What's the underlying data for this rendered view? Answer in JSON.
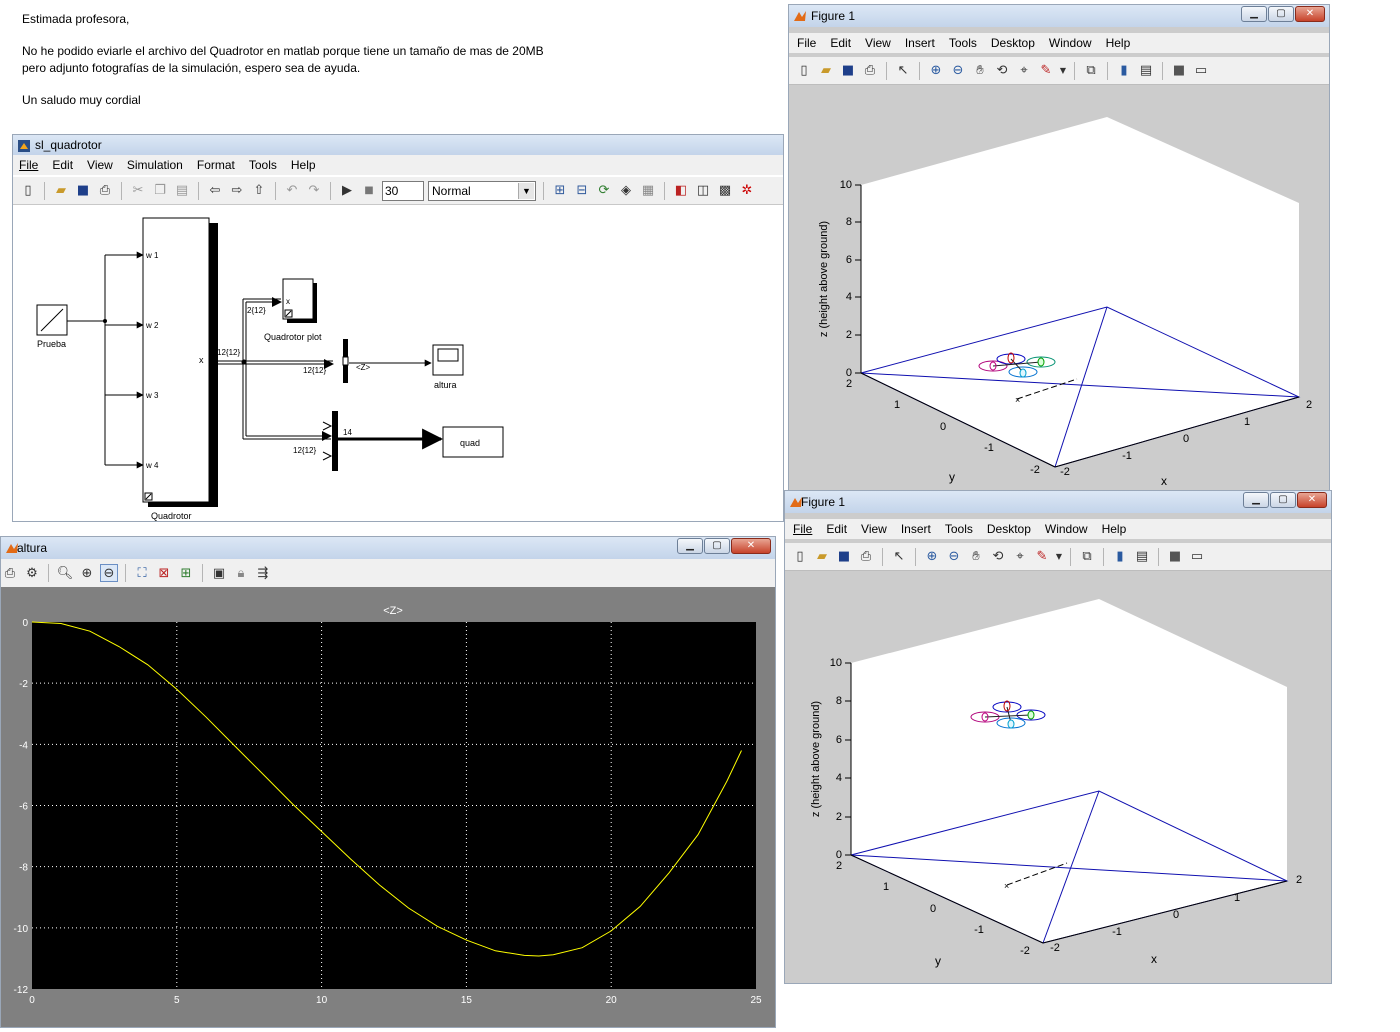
{
  "email": {
    "greeting": "Estimada profesora,",
    "line1": "No he podido eviarle el archivo del Quadrotor en matlab porque tiene un tamaño de mas de 20MB",
    "line2": "pero adjunto fotografías de la simulación, espero sea de ayuda.",
    "closing": "Un saludo muy cordial"
  },
  "simulink": {
    "title": "sl_quadrotor",
    "menu": [
      "File",
      "Edit",
      "View",
      "Simulation",
      "Format",
      "Tools",
      "Help"
    ],
    "stop_time": "30",
    "mode": "Normal",
    "blocks": {
      "prueba": "Prueba",
      "quadrotor": "Quadrotor",
      "quadrotor_plot": "Quadrotor plot",
      "altura": "altura",
      "quad": "quad",
      "w1": "w 1",
      "w2": "w 2",
      "w3": "w 3",
      "w4": "w 4",
      "x_out": "x",
      "x_in": "x",
      "z_sel": "<Z>",
      "sig1": "12{12}",
      "sig2": "2{12}",
      "sig3": "12{12}",
      "sig4": "12{12}",
      "sig5": "14"
    }
  },
  "altura_scope": {
    "title": "altura",
    "plot_title": "<Z>",
    "y_ticks": [
      "0",
      "-2",
      "-4",
      "-6",
      "-8",
      "-10",
      "-12"
    ],
    "x_ticks": [
      "0",
      "5",
      "10",
      "15",
      "20",
      "25"
    ],
    "trace_color": "#ffff00",
    "background_color": "#000000"
  },
  "chart_data": {
    "type": "line",
    "title": "<Z>",
    "xlabel": "",
    "ylabel": "",
    "xlim": [
      0,
      25
    ],
    "ylim": [
      -12,
      0
    ],
    "grid": true,
    "x": [
      0,
      1,
      2,
      3,
      4,
      5,
      6,
      7,
      8,
      9,
      10,
      11,
      12,
      13,
      14,
      15,
      16,
      17,
      17.5,
      18,
      19,
      20,
      21,
      22,
      23,
      24,
      24.5
    ],
    "series": [
      {
        "values": [
          0,
          -0.05,
          -0.3,
          -0.8,
          -1.4,
          -2.2,
          -3.1,
          -4.05,
          -5.0,
          -5.95,
          -6.85,
          -7.75,
          -8.6,
          -9.35,
          -9.95,
          -10.4,
          -10.75,
          -10.9,
          -10.92,
          -10.88,
          -10.65,
          -10.1,
          -9.3,
          -8.2,
          -6.95,
          -5.2,
          -4.2
        ]
      }
    ]
  },
  "figure_top": {
    "title": "Figure 1",
    "menu": [
      "File",
      "Edit",
      "View",
      "Insert",
      "Tools",
      "Desktop",
      "Window",
      "Help"
    ],
    "zlabel": "z (height above ground)",
    "xlabel": "x",
    "ylabel": "y",
    "z_ticks": [
      "10",
      "8",
      "6",
      "4",
      "2",
      "0"
    ],
    "y_ticks": [
      "2",
      "1",
      "0",
      "-1",
      "-2"
    ],
    "x_ticks": [
      "-2",
      "-1",
      "0",
      "1",
      "2"
    ]
  },
  "figure_bottom": {
    "title": "Figure 1",
    "menu": [
      "File",
      "Edit",
      "View",
      "Insert",
      "Tools",
      "Desktop",
      "Window",
      "Help"
    ],
    "zlabel": "z (height above ground)",
    "xlabel": "x",
    "ylabel": "y",
    "z_ticks": [
      "10",
      "8",
      "6",
      "4",
      "2",
      "0"
    ],
    "y_ticks": [
      "2",
      "1",
      "0",
      "-1",
      "-2"
    ],
    "x_ticks": [
      "-2",
      "-1",
      "0",
      "1",
      "2"
    ]
  },
  "colors": {
    "axis_blue": "#1010b0",
    "figure_bg": "#cccccc",
    "title_bar": "#c3d4ea"
  }
}
